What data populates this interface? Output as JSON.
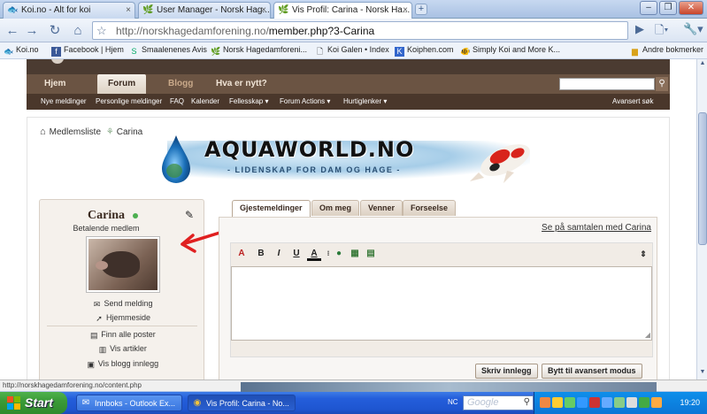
{
  "browser": {
    "tabs": [
      {
        "label": "Koi.no - Alt for koi",
        "active": false
      },
      {
        "label": "User Manager - Norsk Hag...",
        "active": false
      },
      {
        "label": "Vis Profil: Carina - Norsk Ha...",
        "active": true
      }
    ],
    "new_tab": "+",
    "url_host": "http://norskhagedamforening.no/",
    "url_path": "member.php?3-Carina",
    "bookmarks": [
      "Koi.no",
      "Facebook | Hjem",
      "Smaalenenes Avis",
      "Norsk Hagedamforeni...",
      "Koi Galen • Index",
      "Koiphen.com",
      "Simply Koi and More K...",
      "Andre bokmerker"
    ]
  },
  "site": {
    "nav": [
      "Hjem",
      "Forum",
      "Blogg",
      "Hva er nytt?"
    ],
    "subnav": [
      "Nye meldinger",
      "Personlige meldinger",
      "FAQ",
      "Kalender",
      "Fellesskap ▾",
      "Forum Actions ▾",
      "Hurtiglenker ▾",
      "Avansert søk"
    ],
    "breadcrumb": [
      "Medlemsliste",
      "Carina"
    ],
    "banner_title": "AQUAWORLD.NO",
    "banner_tagline": "- LIDENSKAP FOR DAM OG HAGE -"
  },
  "profile": {
    "name": "Carina",
    "rank": "Betalende medlem",
    "links": [
      "Send melding",
      "Hjemmeside",
      "Finn alle poster",
      "Vis artikler",
      "Vis blogg innlegg"
    ]
  },
  "profile_tabs": [
    "Gjestemeldinger",
    "Om meg",
    "Venner",
    "Forseelse"
  ],
  "messages": {
    "conversation_link": "Se på samtalen med Carina",
    "post_button": "Skriv innlegg",
    "advanced_button": "Bytt til avansert modus"
  },
  "status": {
    "url": "http://norskhagedamforening.no/content.php"
  },
  "taskbar": {
    "start": "Start",
    "tasks": [
      "Innboks - Outlook Ex...",
      "Vis Profil: Carina - No..."
    ],
    "nc": "NC",
    "search_placeholder": "Google",
    "clock": "19:20"
  },
  "colors": {
    "site_header": "#4b3b31",
    "site_nav": "#6b5443",
    "taskbar": "#245edb",
    "annotation_arrow": "#e02020"
  }
}
